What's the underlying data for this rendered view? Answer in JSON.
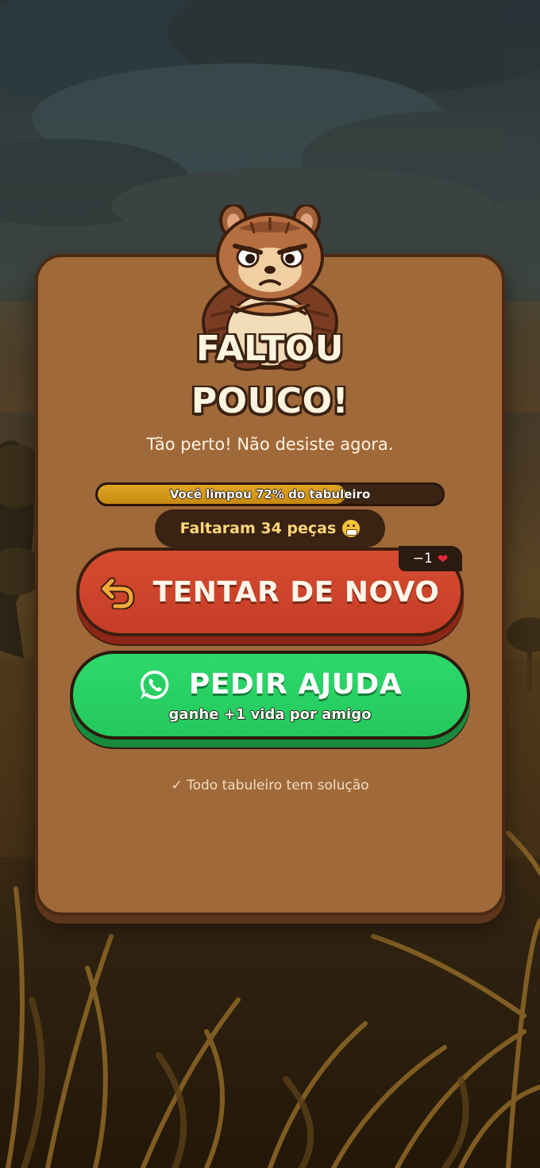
{
  "result": {
    "title_line1": "FALTOU",
    "title_line2": "POUCO!",
    "subtitle": "Tão perto! Não desiste agora."
  },
  "progress": {
    "percent": 72,
    "label": "Você limpou 72% do tabuleiro"
  },
  "remaining": {
    "text": "Faltaram 34 peças",
    "emoji_icon": "grimacing-face-icon"
  },
  "retry_button": {
    "label": "TENTAR DE NOVO",
    "icon": "undo-arrow-icon",
    "cost_text": "−1",
    "cost_icon": "heart-icon"
  },
  "help_button": {
    "label": "PEDIR AJUDA",
    "sublabel": "ganhe +1 vida por amigo",
    "icon": "whatsapp-icon"
  },
  "footnote": "✓ Todo tabuleiro tem solução",
  "colors": {
    "panel": "#a0693a",
    "retry": "#c94328",
    "help": "#27cf63",
    "progress_fill": "#d39a1a"
  }
}
